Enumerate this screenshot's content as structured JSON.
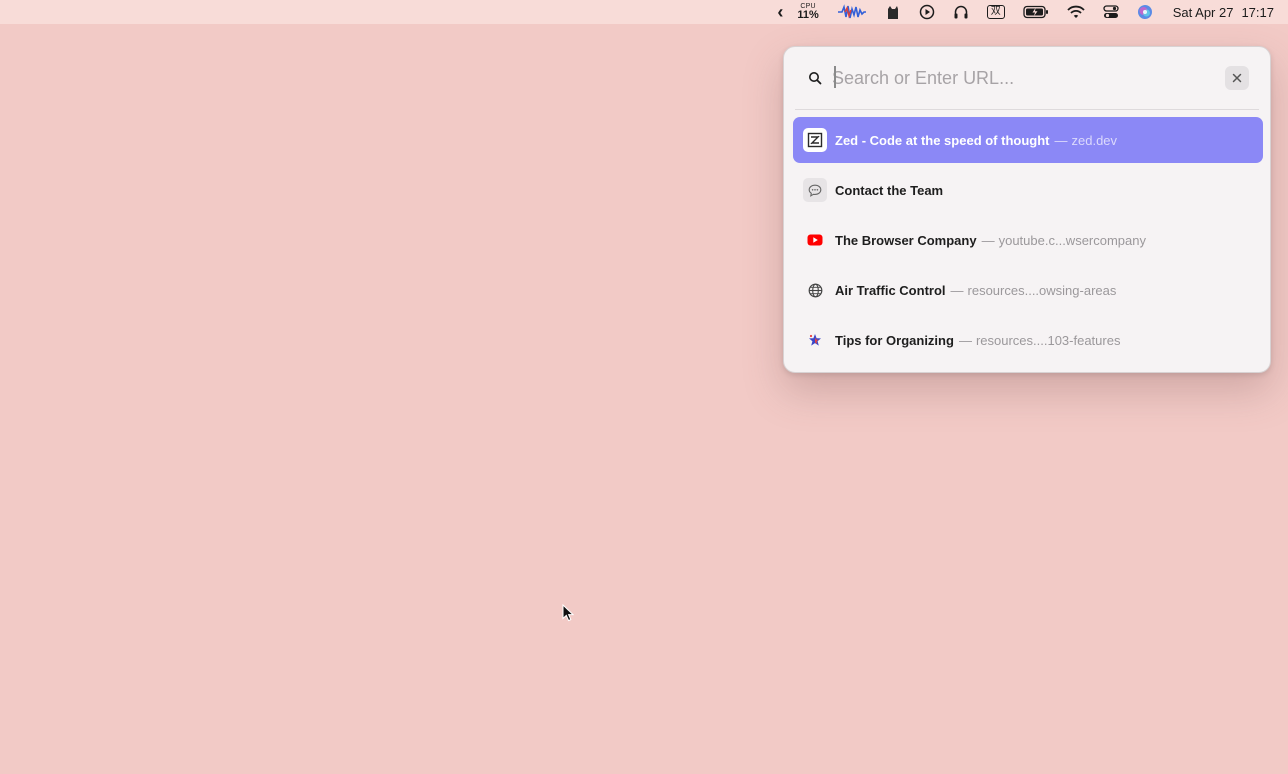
{
  "menubar": {
    "back_chevron": "‹",
    "cpu_label": "CPU",
    "cpu_value": "11%",
    "input_method": "双",
    "date": "Sat Apr 27",
    "time": "17:17",
    "icons": [
      "chevron-left-icon",
      "audio-waveform-icon",
      "cat-icon",
      "play-circle-icon",
      "headphones-icon",
      "input-method-icon",
      "battery-icon",
      "wifi-icon",
      "control-center-icon",
      "siri-icon"
    ]
  },
  "launcher": {
    "search_placeholder": "Search or Enter URL...",
    "search_value": "",
    "results": [
      {
        "title": "Zed - Code at the speed of thought",
        "separator": "—",
        "url": "zed.dev",
        "icon": "zed-logo-icon",
        "selected": true
      },
      {
        "title": "Contact the Team",
        "separator": "",
        "url": "",
        "icon": "chat-bubble-icon",
        "selected": false
      },
      {
        "title": "The Browser Company",
        "separator": "—",
        "url": "youtube.c...wsercompany",
        "icon": "youtube-icon",
        "selected": false
      },
      {
        "title": "Air Traffic Control",
        "separator": "—",
        "url": "resources....owsing-areas",
        "icon": "globe-icon",
        "selected": false
      },
      {
        "title": "Tips for Organizing",
        "separator": "—",
        "url": "resources....103-features",
        "icon": "star-sparkle-icon",
        "selected": false
      }
    ]
  },
  "colors": {
    "desktop": "#f2cac6",
    "menubar": "#f8dcd8",
    "selection": "#8b88f6",
    "youtube_red": "#ff0000"
  }
}
